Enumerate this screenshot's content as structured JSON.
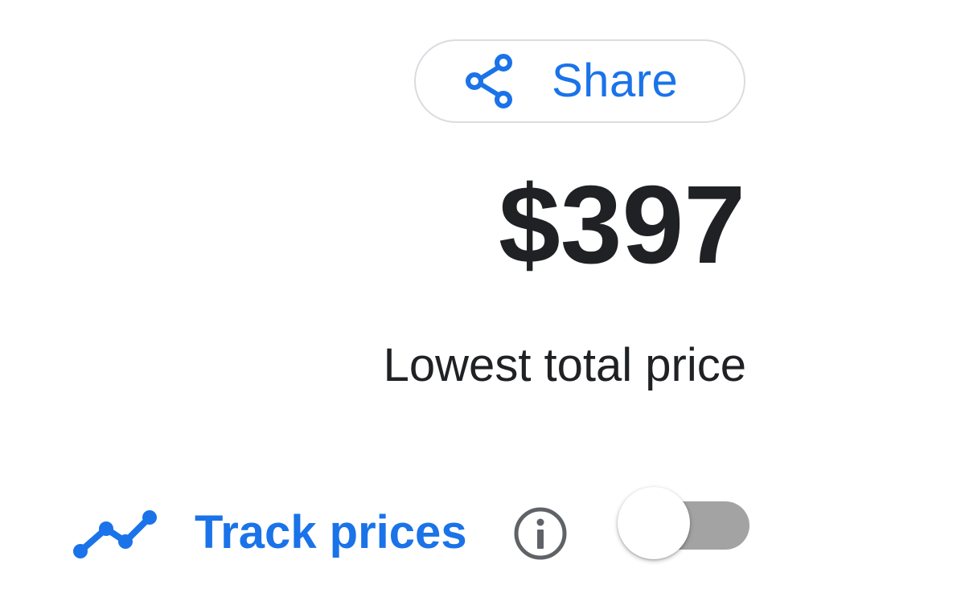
{
  "share": {
    "label": "Share",
    "icon": "share-icon"
  },
  "price": {
    "amount": "$397",
    "caption": "Lowest total price"
  },
  "tracking": {
    "label": "Track prices",
    "trend_icon": "trending-line-icon",
    "info_icon": "info-icon",
    "toggle_state": "off"
  },
  "colors": {
    "accent": "#1a73e8",
    "text": "#202124",
    "border": "#dadce0",
    "toggle_track_off": "#a3a3a3",
    "info_icon": "#5f6368"
  }
}
